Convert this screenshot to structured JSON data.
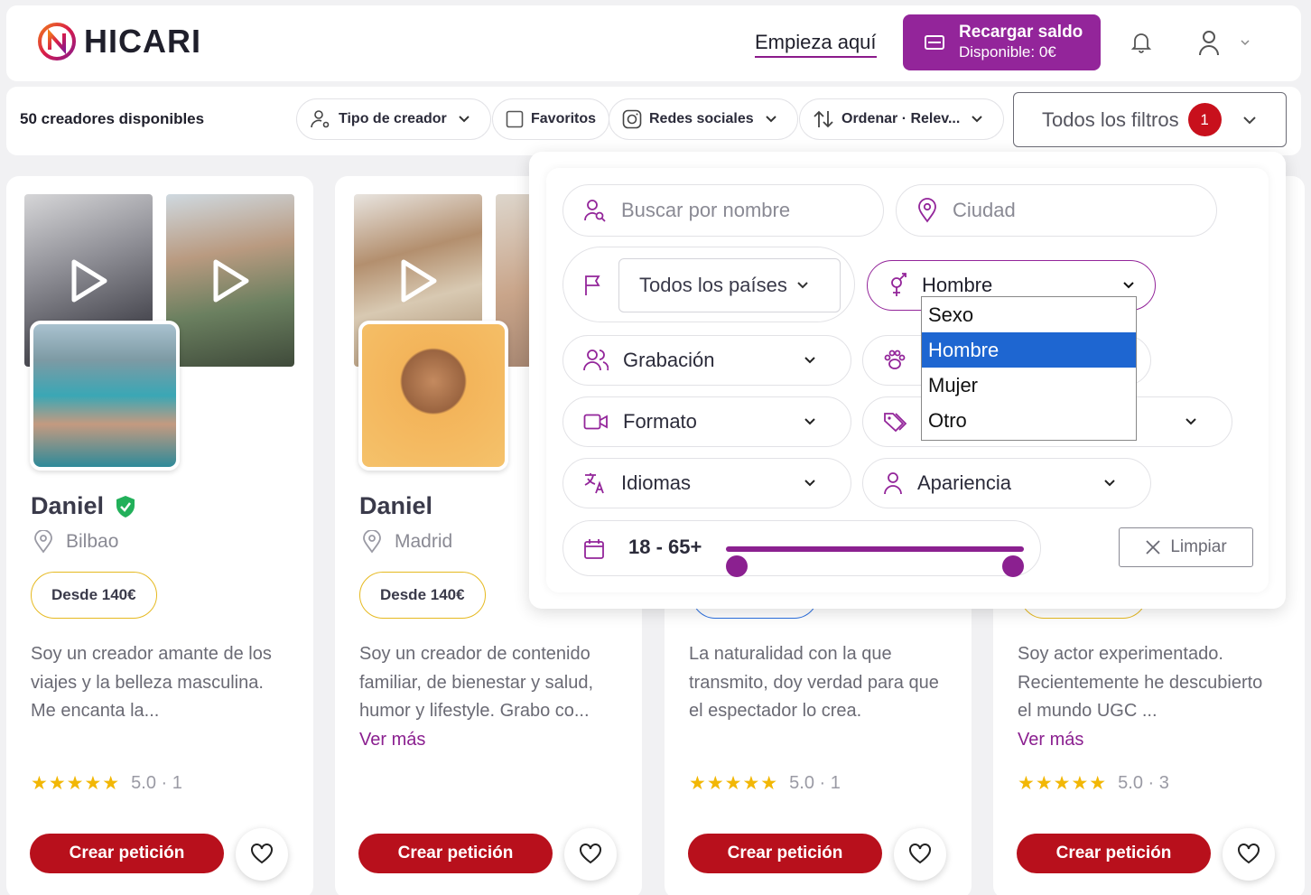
{
  "brand": {
    "name": "HICARI",
    "accent": "#93259a",
    "cta": "#b8101c"
  },
  "header": {
    "start_link": "Empieza aquí",
    "topup_label": "Recargar saldo",
    "topup_balance": "Disponible: 0€"
  },
  "filterbar": {
    "count": "50 creadores disponibles",
    "creator_type": "Tipo de creador",
    "favorites": "Favoritos",
    "social": "Redes sociales",
    "sort": "Ordenar · Relev...",
    "all_filters": "Todos los filtros",
    "active_count": "1"
  },
  "panel": {
    "search_placeholder": "Buscar por nombre",
    "city_placeholder": "Ciudad",
    "country": "Todos los países",
    "sex_value": "Hombre",
    "sex_options": [
      "Sexo",
      "Hombre",
      "Mujer",
      "Otro"
    ],
    "recording": "Grabación",
    "format": "Formato",
    "languages": "Idiomas",
    "appearance": "Apariencia",
    "age_range": "18 - 65+",
    "clear": "Limpiar"
  },
  "cards": [
    {
      "name": "Daniel",
      "verified": true,
      "city": "Bilbao",
      "price": "Desde 140€",
      "bio": "Soy un creador amante de los viajes y la belleza masculina. Me encanta la...",
      "more": "",
      "stars": "★★★★★",
      "rating": "5.0 · 1",
      "cta": "Crear petición"
    },
    {
      "name": "Daniel",
      "verified": false,
      "city": "Madrid",
      "price": "Desde 140€",
      "bio": "Soy un creador de contenido familiar, de bienestar y salud, humor y lifestyle. Grabo co...",
      "more": "Ver más",
      "stars": "",
      "rating": "",
      "cta": "Crear petición"
    },
    {
      "name": "",
      "verified": false,
      "city": "",
      "price": "",
      "bio": "La naturalidad con la que transmito, doy verdad para que el espectador lo crea.",
      "more": "",
      "stars": "★★★★★",
      "rating": "5.0 · 1",
      "cta": "Crear petición"
    },
    {
      "name": "",
      "verified": false,
      "city": "",
      "price": "",
      "bio": "Soy actor experimentado. Recientemente he descubierto el mundo UGC ...",
      "more": "Ver más",
      "stars": "★★★★★",
      "rating": "5.0 · 3",
      "cta": "Crear petición"
    }
  ]
}
